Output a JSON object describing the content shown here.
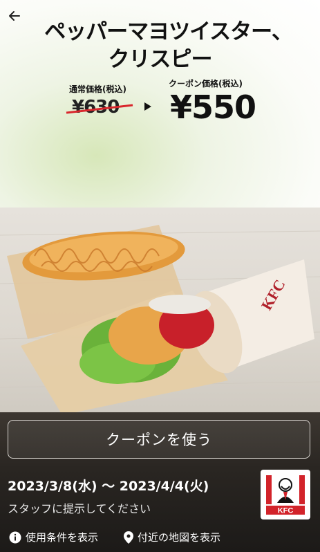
{
  "header": {
    "title_line1": "ペッパーマヨツイスター、",
    "title_line2": "クリスピー",
    "back_icon": "back-arrow-icon"
  },
  "pricing": {
    "regular_label": "通常価格(税込)",
    "regular_price": "¥630",
    "coupon_label": "クーポン価格(税込)",
    "coupon_price": "¥550",
    "strike_color": "#d9262c"
  },
  "product_image": {
    "logo_text": "KFC"
  },
  "coupon": {
    "use_button_label": "クーポンを使う",
    "validity": "2023/3/8(水) 〜 2023/4/4(火)",
    "staff_note": "スタッフに提示してください",
    "brand_logo_text": "KFC"
  },
  "footer": {
    "terms_label": "使用条件を表示",
    "terms_icon": "info-icon",
    "map_label": "付近の地図を表示",
    "map_icon": "location-pin-icon"
  }
}
